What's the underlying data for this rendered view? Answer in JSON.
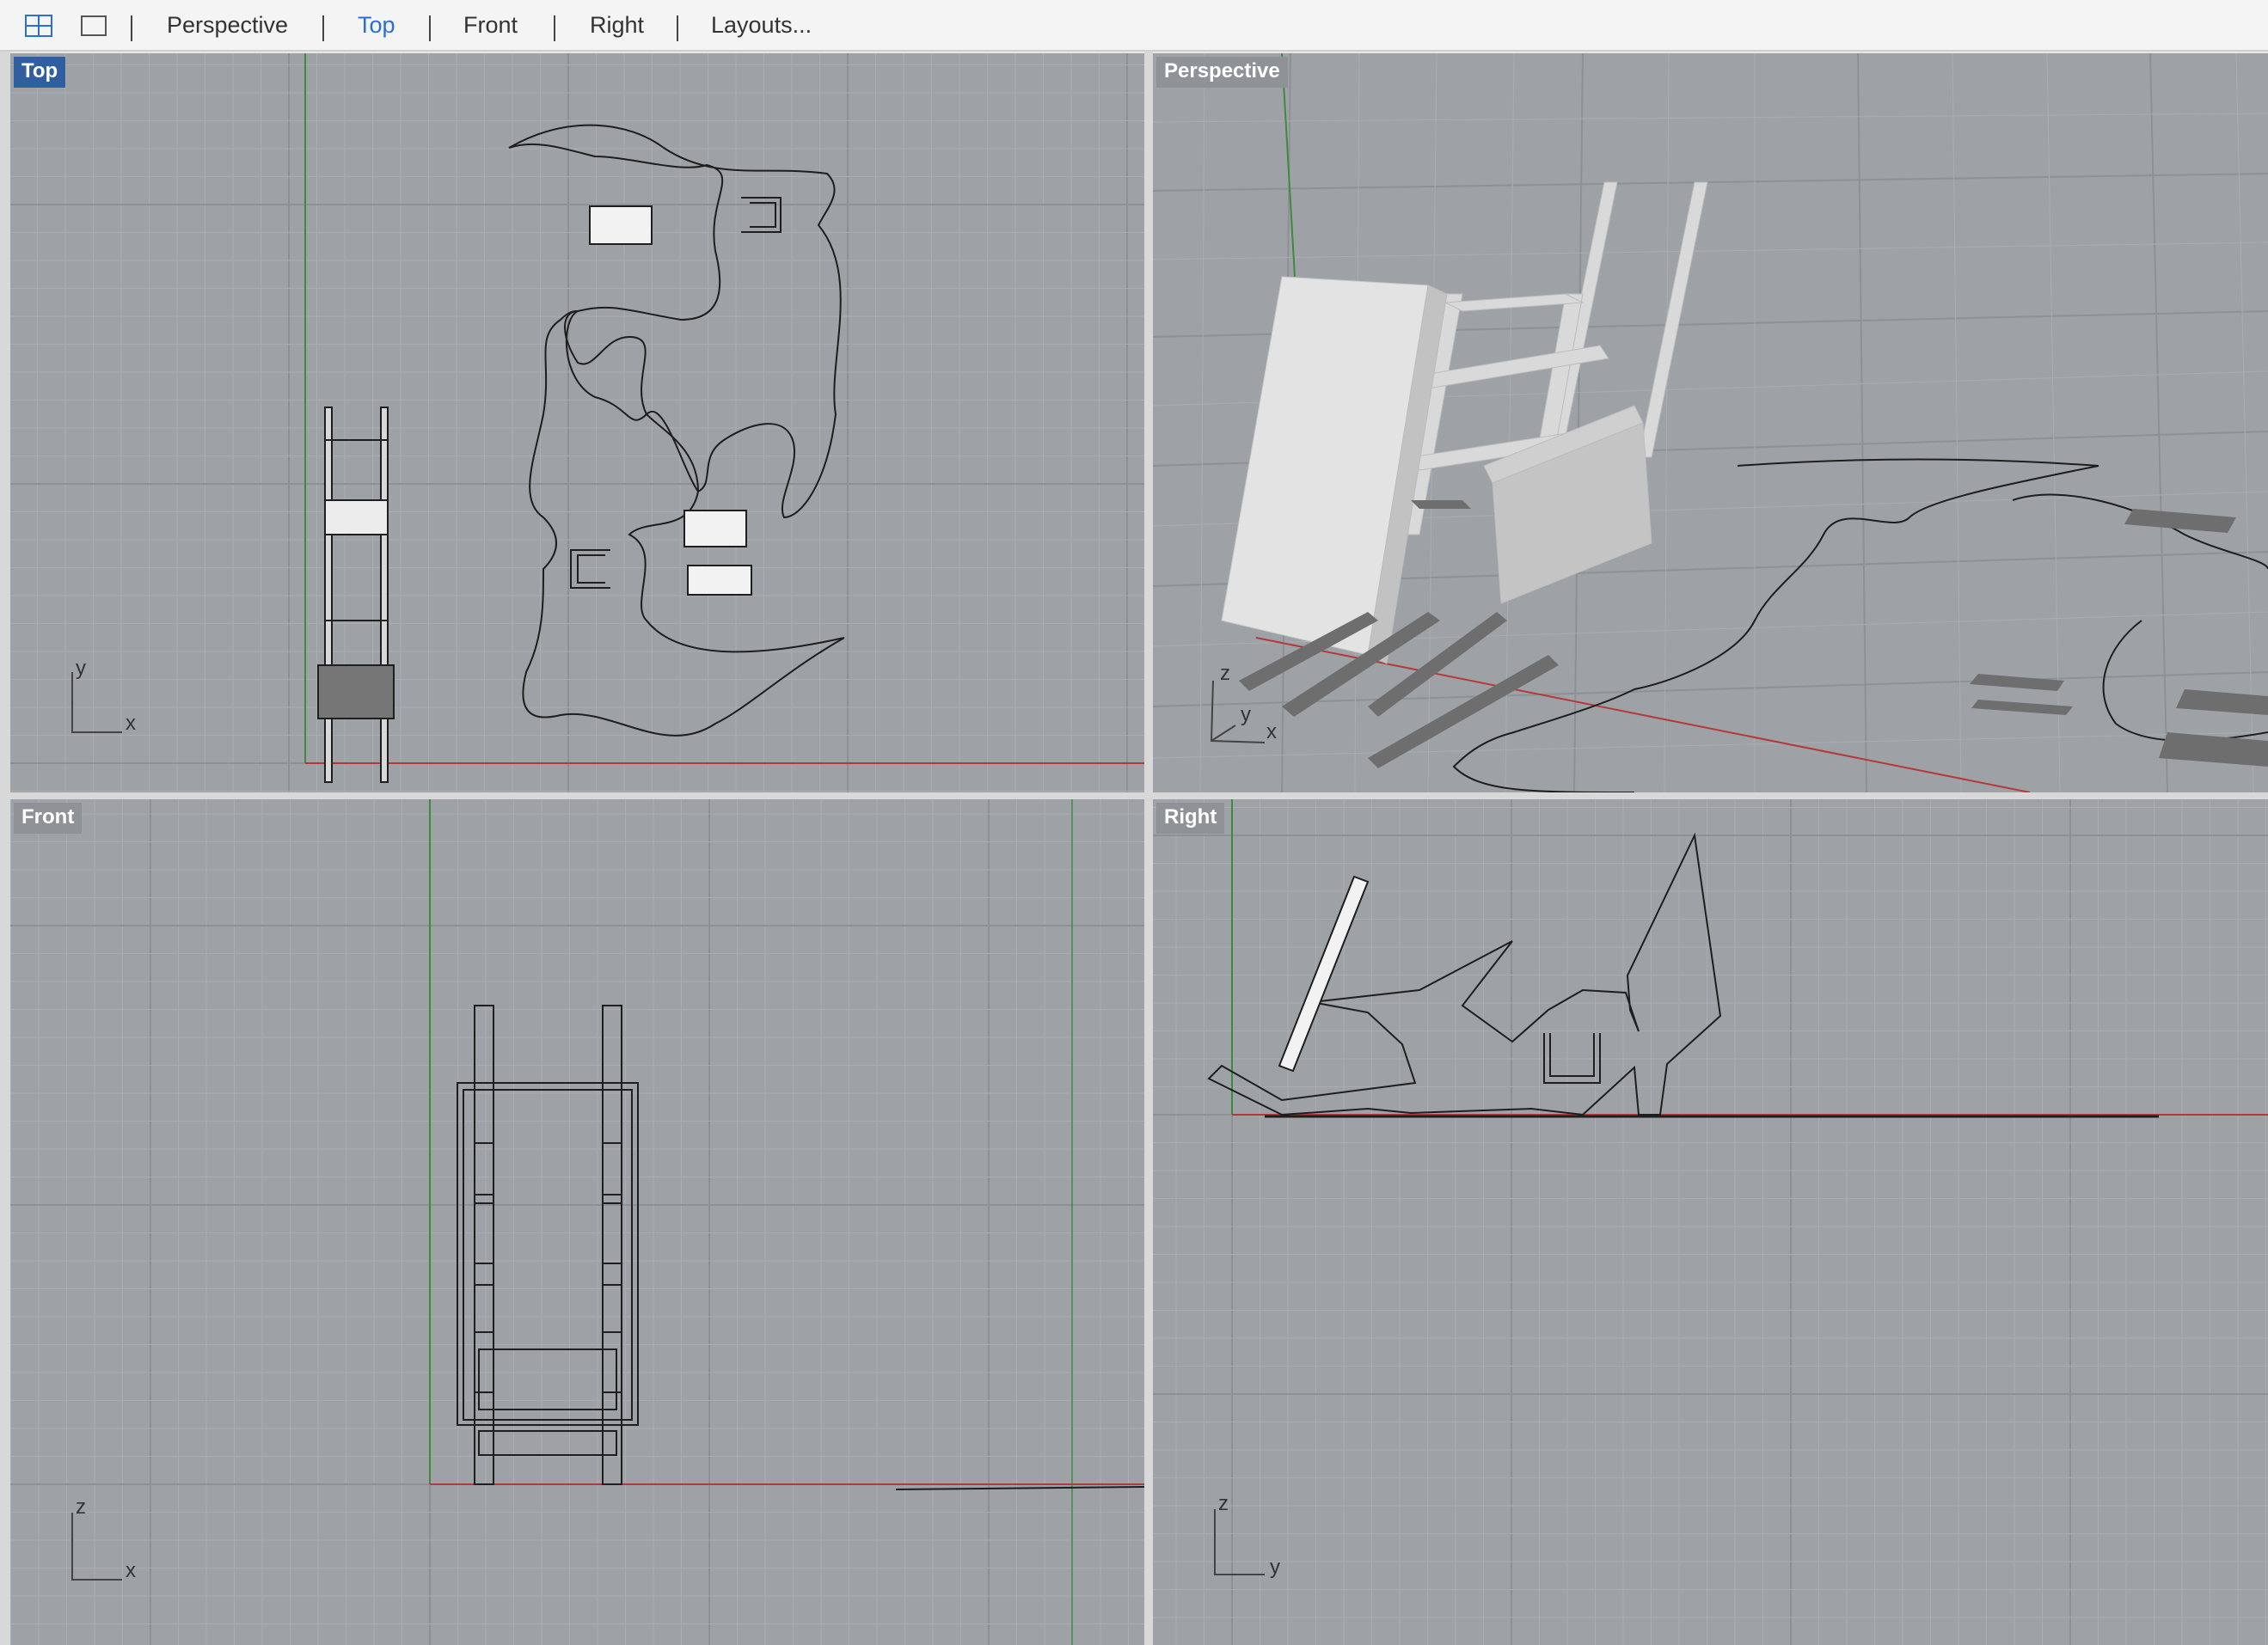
{
  "toolbar": {
    "tabs": [
      {
        "label": "Perspective",
        "active": false
      },
      {
        "label": "Top",
        "active": true
      },
      {
        "label": "Front",
        "active": false
      },
      {
        "label": "Right",
        "active": false
      },
      {
        "label": "Layouts...",
        "active": false
      }
    ],
    "icons": [
      "four-viewports-icon",
      "single-viewport-icon"
    ]
  },
  "viewports": {
    "top": {
      "label": "Top",
      "active": true,
      "axis_labels": [
        "y",
        "x"
      ]
    },
    "perspective": {
      "label": "Perspective",
      "active": false,
      "axis_labels": [
        "z",
        "y",
        "x"
      ]
    },
    "front": {
      "label": "Front",
      "active": false,
      "axis_labels": [
        "z",
        "x"
      ]
    },
    "right": {
      "label": "Right",
      "active": false,
      "axis_labels": [
        "z",
        "y"
      ]
    }
  },
  "colors": {
    "viewport_bg": "#9ea2a6",
    "grid_minor": "#a9adb1",
    "grid_major": "#8d9195",
    "x_axis": "#b33a3a",
    "y_axis": "#3e8a3e",
    "active_label": "#2f5f9e",
    "active_tab": "#2a6ed8"
  }
}
